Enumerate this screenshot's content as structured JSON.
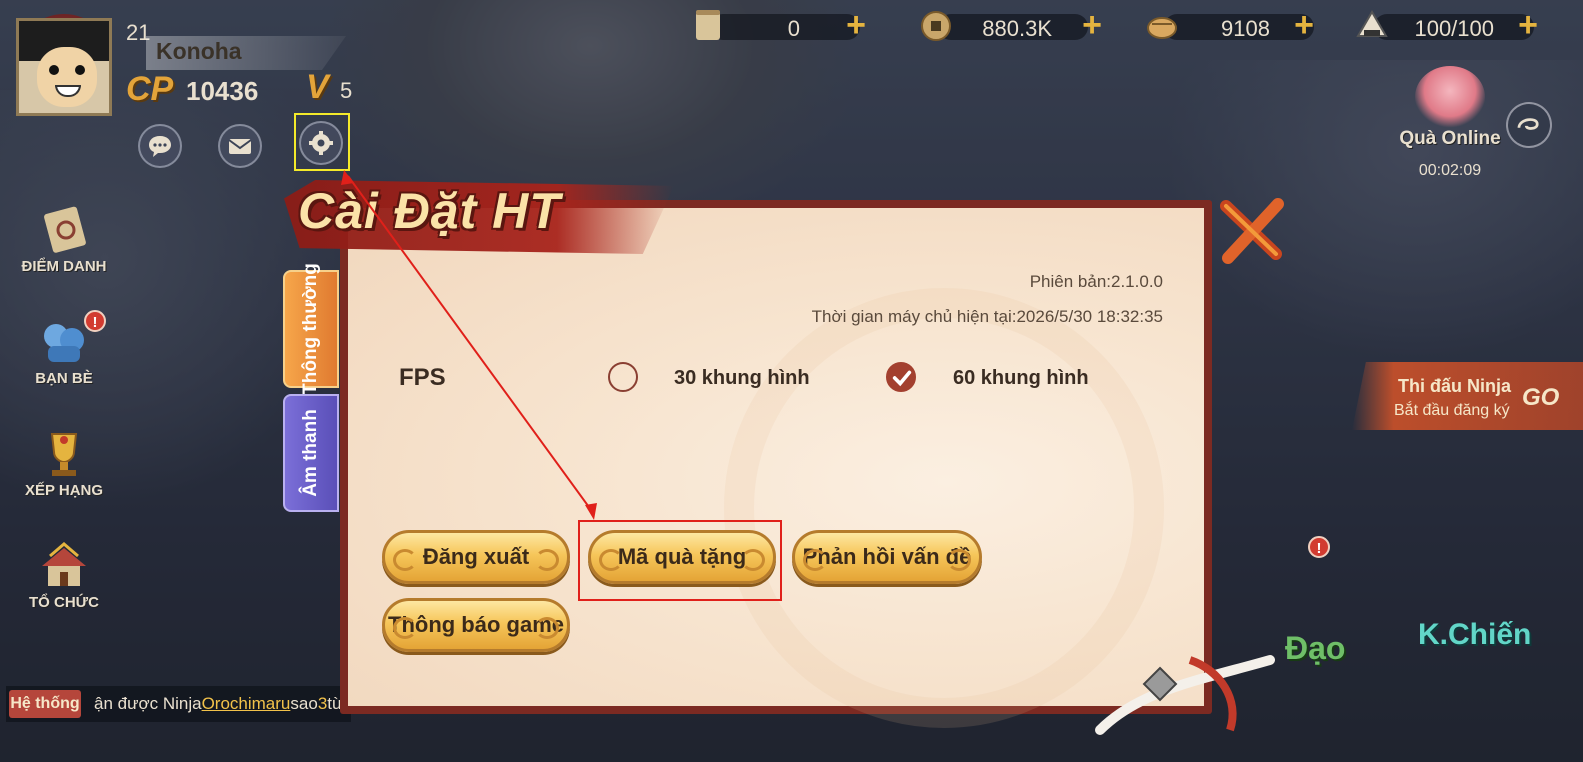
{
  "player": {
    "level": "21",
    "name": "Konoha",
    "cp_label": "CP",
    "cp_value": "10436",
    "vip_label": "V",
    "vip_value": "5"
  },
  "resources": [
    {
      "icon": "scroll-icon",
      "value": "0"
    },
    {
      "icon": "coin-icon",
      "value": "880.3K"
    },
    {
      "icon": "ingot-icon",
      "value": "9108"
    },
    {
      "icon": "stamina-icon",
      "value": "100/100"
    }
  ],
  "left_menu": [
    {
      "label": "ĐIỂM DANH",
      "icon": "checkin-scroll-icon",
      "badge": ""
    },
    {
      "label": "BẠN BÈ",
      "icon": "friends-icon",
      "badge": "!"
    },
    {
      "label": "XẾP HẠNG",
      "icon": "trophy-icon",
      "badge": ""
    },
    {
      "label": "TỔ CHỨC",
      "icon": "organization-icon",
      "badge": ""
    }
  ],
  "gift_online": {
    "title": "Quà Online",
    "timer": "00:02:09"
  },
  "tournament": {
    "title": "Thi đấu Ninja",
    "subtitle": "Bắt đầu đăng ký",
    "go": "GO"
  },
  "bottom_right": {
    "dao": "Đạo",
    "kchien": "K.Chiến"
  },
  "system_bar": {
    "tag": "Hệ thống",
    "prefix": "ận được Ninja",
    "ninja": "Orochimaru",
    "middle": "sao",
    "stars": "3",
    "suffix": "từ rư"
  },
  "dialog": {
    "title": "Cài Đặt HT",
    "version": "Phiên bản:2.1.0.0",
    "server_time": "Thời gian máy chủ hiện tại:2026/5/30 18:32:35",
    "fps_label": "FPS",
    "fps_options": [
      {
        "label": "30 khung hình",
        "checked": false
      },
      {
        "label": "60 khung hình",
        "checked": true
      }
    ],
    "tabs": [
      {
        "label": "Thông thường",
        "active": true
      },
      {
        "label": "Âm thanh",
        "active": false
      }
    ],
    "buttons": {
      "logout": "Đăng xuất",
      "gift_code": "Mã quà tặng",
      "feedback": "Phản hồi vấn đề",
      "notice": "Thông báo game"
    }
  },
  "colors": {
    "highlight_yellow": "#f4ea2a",
    "highlight_red": "#e0201a",
    "button_gold": "#f6c65a",
    "dialog_frame": "#7c2a22"
  }
}
